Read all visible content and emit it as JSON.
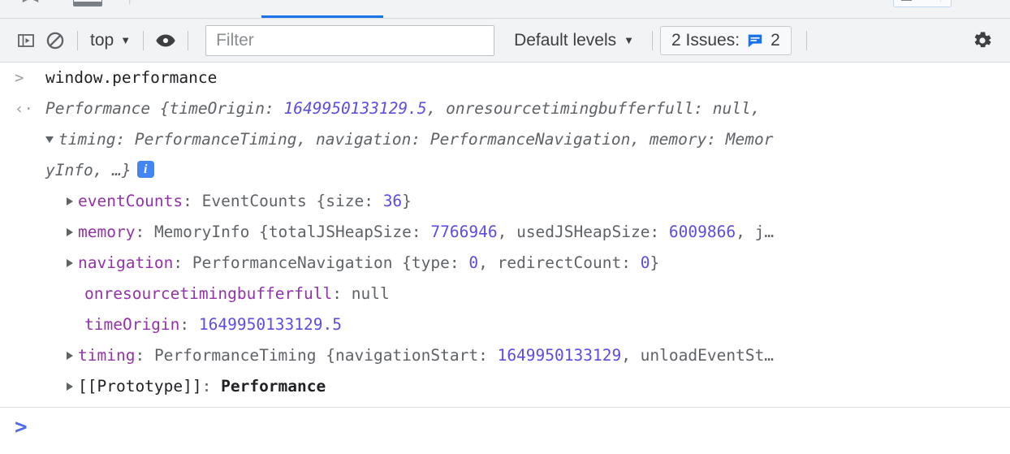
{
  "tabstrip": {
    "partial_labels": [
      "▸▸",
      "⋮"
    ],
    "active_tab_accent": "#1a73e8"
  },
  "toolbar": {
    "sidebar_toggle": "show-console-sidebar-icon",
    "clear_console": "clear-console-icon",
    "context_label": "top",
    "context_caret": "▼",
    "live_expression": "eye-icon",
    "filter_placeholder": "Filter",
    "filter_value": "",
    "levels_label": "Default levels",
    "levels_caret": "▼",
    "issues_label": "2 Issues:",
    "issues_count": "2",
    "issues_icon": "issue-message-icon",
    "settings": "gear-icon"
  },
  "console": {
    "input_gutter": ">",
    "output_gutter": "‹·",
    "command": "window.performance",
    "result": {
      "line1_pre": "Performance {timeOrigin: ",
      "line1_num": "1649950133129.5",
      "line1_post": ", onresourcetimingbufferfull: null,",
      "line2": "timing: PerformanceTiming, navigation: PerformanceNavigation, memory: Memor",
      "line3": "yInfo, …}",
      "info_badge": "i"
    },
    "properties": [
      {
        "expandable": true,
        "name": "eventCounts",
        "sep": ": ",
        "type": "EventCounts {size: ",
        "num": "36",
        "tail": "}"
      },
      {
        "expandable": true,
        "name": "memory",
        "sep": ": ",
        "type": "MemoryInfo {totalJSHeapSize: ",
        "num": "7766946",
        "mid": ", usedJSHeapSize: ",
        "num2": "6009866",
        "tail": ", j…"
      },
      {
        "expandable": true,
        "name": "navigation",
        "sep": ": ",
        "type": "PerformanceNavigation {type: ",
        "num": "0",
        "mid": ", redirectCount: ",
        "num2": "0",
        "tail": "}"
      },
      {
        "expandable": false,
        "name": "onresourcetimingbufferfull",
        "sep": ": ",
        "value_null": "null"
      },
      {
        "expandable": false,
        "name": "timeOrigin",
        "sep": ": ",
        "num": "1649950133129.5"
      },
      {
        "expandable": true,
        "name": "timing",
        "sep": ": ",
        "type": "PerformanceTiming {navigationStart: ",
        "num": "1649950133129",
        "tail": ", unloadEventSt…"
      },
      {
        "expandable": true,
        "name_dark": "[[Prototype]]",
        "sep": ": ",
        "proto": "Performance"
      }
    ],
    "prompt_chevron": ">",
    "prompt_value": ""
  },
  "colors": {
    "accent_blue": "#1a73e8",
    "prompt_blue": "#4f6bed",
    "property_purple": "#9333a8",
    "number_violet": "#5b4ee0",
    "toolbar_bg": "#f1f3f4"
  }
}
